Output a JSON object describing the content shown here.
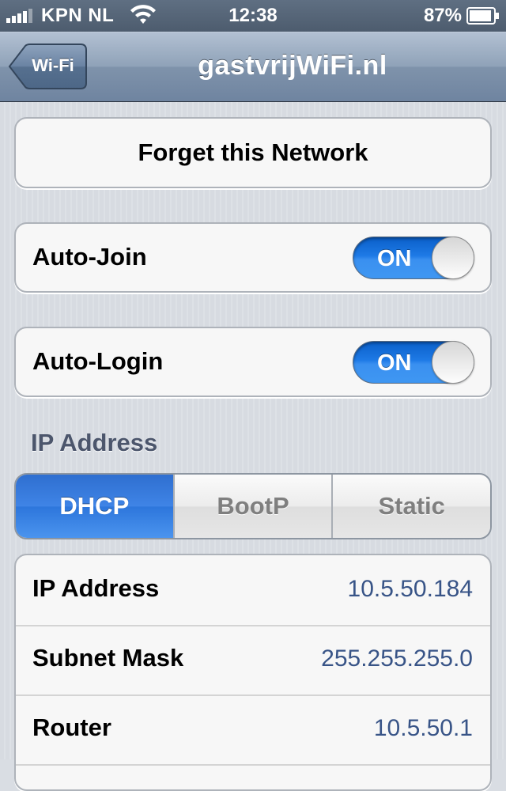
{
  "status_bar": {
    "carrier": "KPN NL",
    "time": "12:38",
    "battery_percent": "87%",
    "signal_icon": "signal-bars-icon",
    "wifi_icon": "wifi-icon",
    "battery_icon": "battery-icon"
  },
  "nav": {
    "back_label": "Wi-Fi",
    "title": "gastvrijWiFi.nl"
  },
  "actions": {
    "forget_label": "Forget this Network"
  },
  "settings": {
    "auto_join_label": "Auto-Join",
    "auto_join_state": "ON",
    "auto_login_label": "Auto-Login",
    "auto_login_state": "ON"
  },
  "ip_section": {
    "header": "IP Address",
    "modes": [
      "DHCP",
      "BootP",
      "Static"
    ],
    "selected_mode": "DHCP"
  },
  "info": {
    "rows": [
      {
        "label": "IP Address",
        "value": "10.5.50.184"
      },
      {
        "label": "Subnet Mask",
        "value": "255.255.255.0"
      },
      {
        "label": "Router",
        "value": "10.5.50.1"
      }
    ]
  },
  "colors": {
    "toggle_on": "#1e7ae6",
    "segment_selected": "#3f84e6",
    "value_text": "#385487",
    "nav_bar": "#8fa2b8"
  }
}
